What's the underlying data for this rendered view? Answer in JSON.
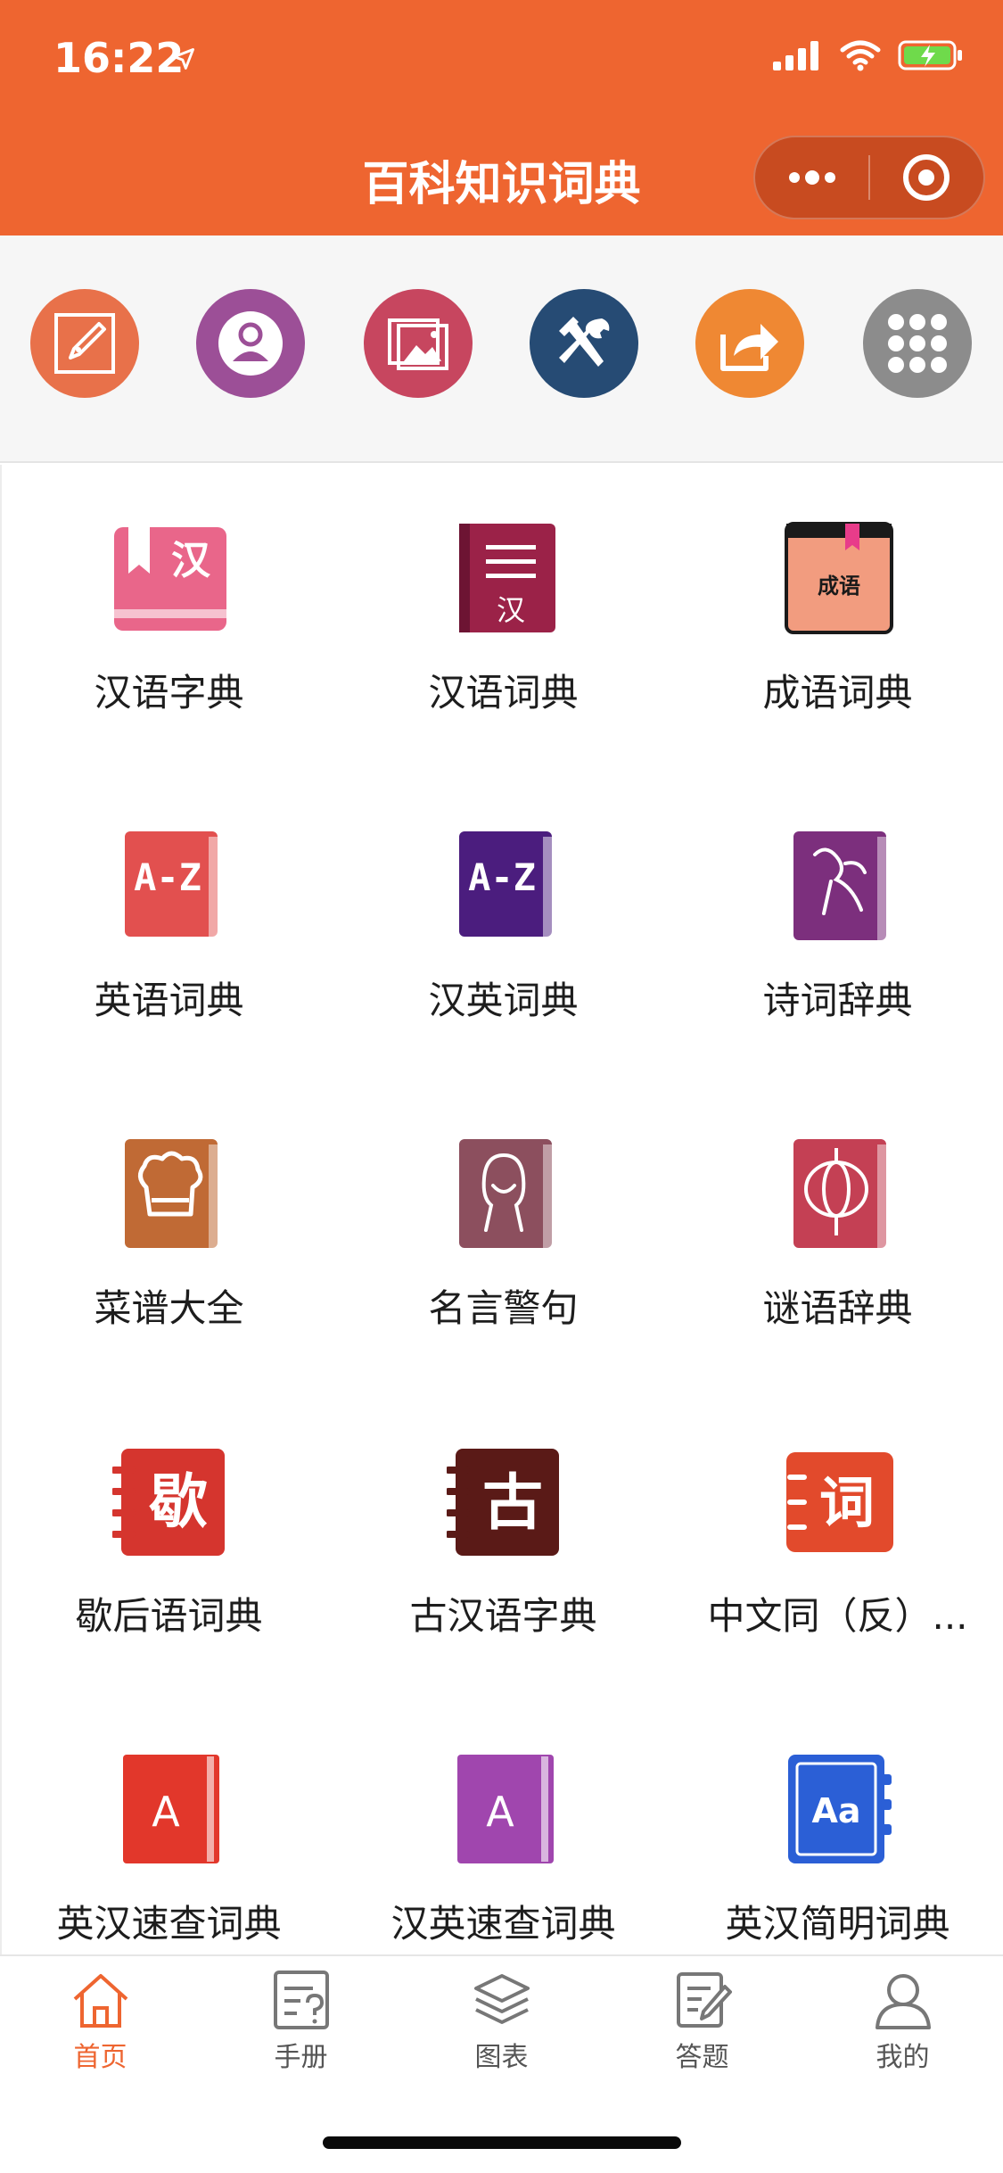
{
  "status_bar": {
    "time": "16:22"
  },
  "nav": {
    "title": "百科知识词典"
  },
  "quick_actions": [
    {
      "icon": "pen-edit-icon",
      "color": "#e8714a"
    },
    {
      "icon": "user-profile-icon",
      "color": "#9c4f97"
    },
    {
      "icon": "image-gallery-icon",
      "color": "#c7465f"
    },
    {
      "icon": "tools-icon",
      "color": "#264b74"
    },
    {
      "icon": "share-icon",
      "color": "#ef8833"
    },
    {
      "icon": "apps-grid-icon",
      "color": "#8c8c8c"
    }
  ],
  "dictionaries": [
    {
      "label": "汉语字典",
      "icon": "hanyu-zidian-icon",
      "color": "#e9668a",
      "glyph": "汉"
    },
    {
      "label": "汉语词典",
      "icon": "hanyu-cidian-icon",
      "color": "#9b2248",
      "glyph": "汉"
    },
    {
      "label": "成语词典",
      "icon": "chengyu-cidian-icon",
      "color": "#f29c7f",
      "glyph": "成语"
    },
    {
      "label": "英语词典",
      "icon": "english-dictionary-icon",
      "color": "#e2504f",
      "glyph": "A-Z"
    },
    {
      "label": "汉英词典",
      "icon": "chinese-english-dictionary-icon",
      "color": "#4b1d7e",
      "glyph": "A-Z"
    },
    {
      "label": "诗词辞典",
      "icon": "poetry-dictionary-icon",
      "color": "#7c2f7d",
      "glyph": ""
    },
    {
      "label": "菜谱大全",
      "icon": "chef-hat-recipe-icon",
      "color": "#c06a35",
      "glyph": ""
    },
    {
      "label": "名言警句",
      "icon": "quotes-book-icon",
      "color": "#8c4f5e",
      "glyph": ""
    },
    {
      "label": "谜语辞典",
      "icon": "lantern-riddle-icon",
      "color": "#c44054",
      "glyph": ""
    },
    {
      "label": "歇后语词典",
      "icon": "xiehouyu-icon",
      "color": "#d5352e",
      "glyph": "歇"
    },
    {
      "label": "古汉语字典",
      "icon": "ancient-chinese-icon",
      "color": "#5a1a17",
      "glyph": "古"
    },
    {
      "label": "中文同（反）...",
      "icon": "synonym-antonym-icon",
      "color": "#e24a2c",
      "glyph": "词"
    },
    {
      "label": "英汉速查词典",
      "icon": "english-chinese-quick-icon",
      "color": "#e2372b",
      "glyph": "A"
    },
    {
      "label": "汉英速查词典",
      "icon": "chinese-english-quick-icon",
      "color": "#a046ae",
      "glyph": "A"
    },
    {
      "label": "英汉简明词典",
      "icon": "english-chinese-concise-icon",
      "color": "#2b5fd6",
      "glyph": "Aa"
    }
  ],
  "tabs": [
    {
      "label": "首页",
      "icon": "home-icon",
      "active": true
    },
    {
      "label": "手册",
      "icon": "manual-icon",
      "active": false
    },
    {
      "label": "图表",
      "icon": "layers-icon",
      "active": false
    },
    {
      "label": "答题",
      "icon": "quiz-icon",
      "active": false
    },
    {
      "label": "我的",
      "icon": "profile-icon",
      "active": false
    }
  ],
  "colors": {
    "accent": "#ee6530",
    "tab_inactive": "#555555"
  }
}
